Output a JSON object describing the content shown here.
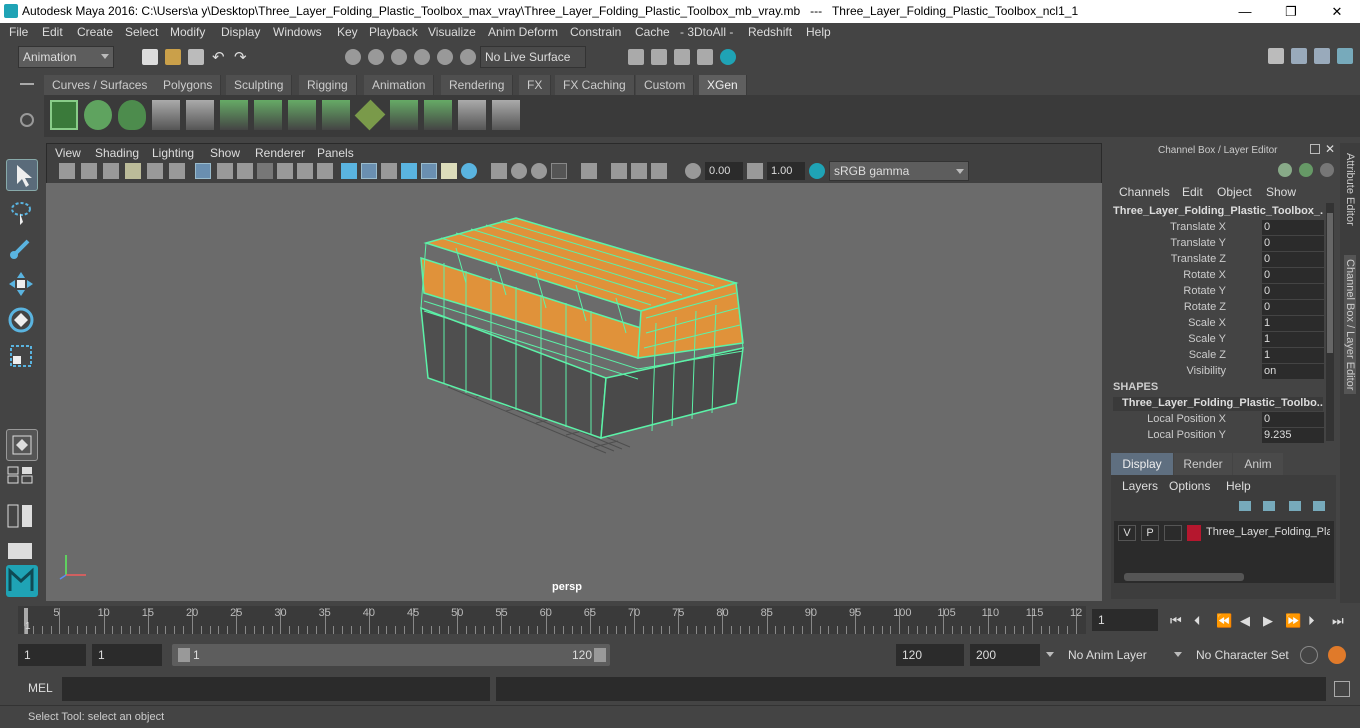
{
  "window": {
    "title": "Autodesk Maya 2016: C:\\Users\\a y\\Desktop\\Three_Layer_Folding_Plastic_Toolbox_max_vray\\Three_Layer_Folding_Plastic_Toolbox_mb_vray.mb   ---   Three_Layer_Folding_Plastic_Toolbox_ncl1_1",
    "minimize": "—",
    "maximize": "❐",
    "close": "✕"
  },
  "menubar": [
    "File",
    "Edit",
    "Create",
    "Select",
    "Modify",
    "Display",
    "Windows",
    "Key",
    "Playback",
    "Visualize",
    "Anim Deform",
    "Constrain",
    "Cache",
    "- 3DtoAll -",
    "Redshift",
    "Help"
  ],
  "toolbar": {
    "menuset": "Animation",
    "live_surface": "No Live Surface"
  },
  "shelf": {
    "tabs": [
      "Curves / Surfaces",
      "Polygons",
      "Sculpting",
      "Rigging",
      "Animation",
      "Rendering",
      "FX",
      "FX Caching",
      "Custom",
      "XGen"
    ],
    "active_tab": "XGen"
  },
  "viewport": {
    "menus": [
      "View",
      "Shading",
      "Lighting",
      "Show",
      "Renderer",
      "Panels"
    ],
    "field1": "0.00",
    "field2": "1.00",
    "color_space": "sRGB gamma",
    "camera_label": "persp"
  },
  "channel_box": {
    "header": "Channel Box / Layer Editor",
    "menus": [
      "Channels",
      "Edit",
      "Object",
      "Show"
    ],
    "object_name": "Three_Layer_Folding_Plastic_Toolbox_...",
    "attributes": [
      {
        "label": "Translate X",
        "value": "0"
      },
      {
        "label": "Translate Y",
        "value": "0"
      },
      {
        "label": "Translate Z",
        "value": "0"
      },
      {
        "label": "Rotate X",
        "value": "0"
      },
      {
        "label": "Rotate Y",
        "value": "0"
      },
      {
        "label": "Rotate Z",
        "value": "0"
      },
      {
        "label": "Scale X",
        "value": "1"
      },
      {
        "label": "Scale Y",
        "value": "1"
      },
      {
        "label": "Scale Z",
        "value": "1"
      },
      {
        "label": "Visibility",
        "value": "on"
      }
    ],
    "shapes_label": "SHAPES",
    "shape_name": "Three_Layer_Folding_Plastic_Toolbo...",
    "shape_attributes": [
      {
        "label": "Local Position X",
        "value": "0"
      },
      {
        "label": "Local Position Y",
        "value": "9.235"
      }
    ]
  },
  "layer_editor": {
    "tabs": [
      "Display",
      "Render",
      "Anim"
    ],
    "active_tab": "Display",
    "menus": [
      "Layers",
      "Options",
      "Help"
    ],
    "layer": {
      "v": "V",
      "p": "P",
      "name": "Three_Layer_Folding_Pla",
      "color": "#b5172e"
    }
  },
  "side_tabs": [
    "Attribute Editor",
    "Channel Box / Layer Editor"
  ],
  "timeline": {
    "ticks": [
      "5",
      "10",
      "15",
      "20",
      "25",
      "30",
      "35",
      "40",
      "45",
      "50",
      "55",
      "60",
      "65",
      "70",
      "75",
      "80",
      "85",
      "90",
      "95",
      "100",
      "105",
      "110",
      "115",
      "12"
    ],
    "start_marker": "1",
    "current_frame": "1"
  },
  "range": {
    "start": "1",
    "anim_start": "1",
    "slider_start": "1",
    "slider_end": "120",
    "end": "120",
    "anim_end": "200",
    "anim_layer": "No Anim Layer",
    "character_set": "No Character Set"
  },
  "mel": {
    "label": "MEL"
  },
  "status": {
    "text": "Select Tool: select an object"
  },
  "colors": {
    "accent": "#1fa3b5",
    "wire": "#5cf2a8",
    "orange": "#e0923a"
  }
}
